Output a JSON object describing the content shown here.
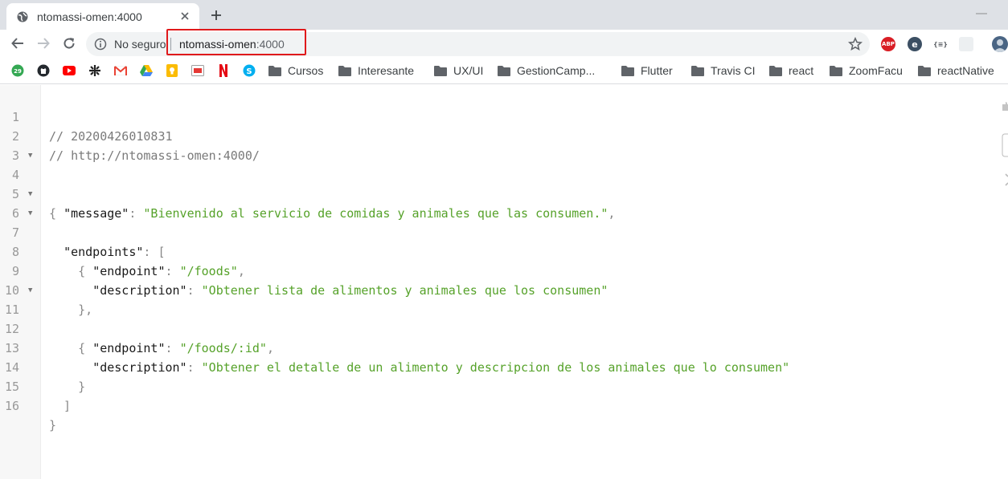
{
  "tab": {
    "title": "ntomassi-omen:4000",
    "favicon": "globe-icon"
  },
  "toolbar": {
    "security_text": "No seguro",
    "url_host": "ntomassi-omen",
    "url_port": ":4000",
    "extensions": [
      {
        "name": "adblock-plus-icon",
        "text": "ABP",
        "color": "#d91e25"
      },
      {
        "name": "extension-e-icon",
        "text": "e",
        "color": "#3c4f63"
      },
      {
        "name": "json-viewer-icon",
        "text": "{≡}",
        "color": "#5f6368"
      }
    ]
  },
  "bookmarks": {
    "icons": [
      {
        "name": "calendar-29-icon",
        "text": "29",
        "color": "#34a853"
      },
      {
        "name": "github-icon",
        "color": "#24292e"
      },
      {
        "name": "youtube-icon",
        "color": "#ff0000"
      },
      {
        "name": "utn-logo-icon",
        "color": "#222222"
      },
      {
        "name": "gmail-icon",
        "color": "#ea4335"
      },
      {
        "name": "google-drive-icon",
        "color": "#34a853"
      },
      {
        "name": "keep-icon",
        "color": "#fbbc04"
      },
      {
        "name": "slides-icon",
        "color": "#9e9e9e"
      },
      {
        "name": "netflix-icon",
        "color": "#e50914"
      },
      {
        "name": "skype-icon",
        "color": "#00aff0"
      }
    ],
    "folders": [
      "Cursos",
      "Interesante",
      "UX/UI",
      "GestionCamp...",
      "Flutter",
      "Travis CI",
      "react",
      "ZoomFacu",
      "reactNative"
    ]
  },
  "code": {
    "comment1": "// 20200426010831",
    "comment2": "// http://ntomassi-omen:4000/",
    "message_key": "\"message\"",
    "message_value": "\"Bienvenido al servicio de comidas y animales que las consumen.\"",
    "endpoints_key": "\"endpoints\"",
    "ep_key": "\"endpoint\"",
    "desc_key": "\"description\"",
    "ep1_value": "\"/foods\"",
    "ep1_desc": "\"Obtener lista de alimentos y animales que los consumen\"",
    "ep2_value": "\"/foods/:id\"",
    "ep2_desc": "\"Obtener el detalle de un alimento y descripcion de los animales que lo consumen\""
  }
}
